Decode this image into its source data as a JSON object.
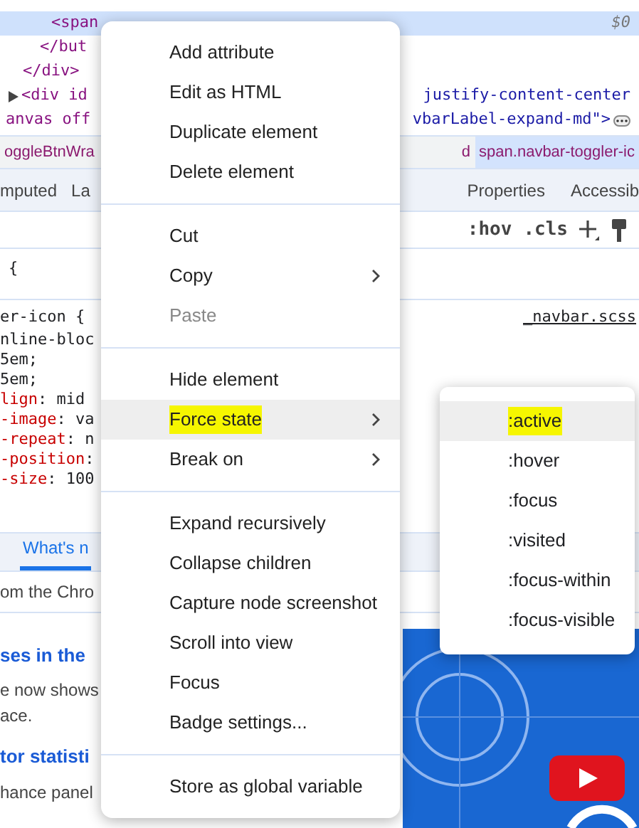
{
  "elements_panel": {
    "lines": [
      {
        "left": "<span",
        "right": "$0",
        "selected": true
      },
      {
        "left": "</but",
        "selected": false
      },
      {
        "left": "</div>",
        "selected": false
      },
      {
        "left": "<div id",
        "right": "justify-content-center",
        "selected": false
      },
      {
        "left": "anvas off",
        "right": "vbarLabel-expand-md\">",
        "selected": false
      }
    ],
    "breadcrumbs": [
      {
        "label": "oggleBtnWra",
        "selected": false
      },
      {
        "label": "d",
        "selected": false
      },
      {
        "label": "span.navbar-toggler-ic",
        "selected": true
      }
    ]
  },
  "sidebar_tabs": [
    {
      "label": "mputed",
      "selected": false
    },
    {
      "label": "La",
      "selected": false
    },
    {
      "label": "Properties",
      "selected": false
    },
    {
      "label": "Accessib",
      "selected": false
    }
  ],
  "styles_toolbar": {
    "hov": ":hov",
    "cls": ".cls"
  },
  "styles": {
    "brace": "{",
    "selector": "er-icon {",
    "source": "_navbar.scss",
    "declarations": [
      {
        "prop": "nline-bloc"
      },
      {
        "prop": "5em;"
      },
      {
        "prop": " 5em;"
      },
      {
        "prop": "lign",
        "value": ": mid"
      },
      {
        "prop": "-image",
        "value": ": va"
      },
      {
        "prop": "-repeat",
        "value": ": n"
      },
      {
        "prop": "-position",
        "value": ":"
      },
      {
        "prop": "-size",
        "value": ": 100"
      }
    ]
  },
  "drawer": {
    "tab": "What's n",
    "intro": "om the Chro",
    "sections": [
      {
        "heading": "ses in the",
        "body": [
          "e now shows",
          "ace."
        ]
      },
      {
        "heading": "tor statisti",
        "body": [
          "hance panel"
        ]
      }
    ]
  },
  "context_menu": {
    "groups": [
      [
        {
          "label": "Add attribute",
          "submenu": false,
          "disabled": false,
          "selected": false,
          "marked": false
        },
        {
          "label": "Edit as HTML",
          "submenu": false,
          "disabled": false,
          "selected": false,
          "marked": false
        },
        {
          "label": "Duplicate element",
          "submenu": false,
          "disabled": false,
          "selected": false,
          "marked": false
        },
        {
          "label": "Delete element",
          "submenu": false,
          "disabled": false,
          "selected": false,
          "marked": false
        }
      ],
      [
        {
          "label": "Cut",
          "submenu": false,
          "disabled": false,
          "selected": false,
          "marked": false
        },
        {
          "label": "Copy",
          "submenu": true,
          "disabled": false,
          "selected": false,
          "marked": false
        },
        {
          "label": "Paste",
          "submenu": false,
          "disabled": true,
          "selected": false,
          "marked": false
        }
      ],
      [
        {
          "label": "Hide element",
          "submenu": false,
          "disabled": false,
          "selected": false,
          "marked": false
        },
        {
          "label": "Force state",
          "submenu": true,
          "disabled": false,
          "selected": true,
          "marked": true
        },
        {
          "label": "Break on",
          "submenu": true,
          "disabled": false,
          "selected": false,
          "marked": false
        }
      ],
      [
        {
          "label": "Expand recursively",
          "submenu": false,
          "disabled": false,
          "selected": false,
          "marked": false
        },
        {
          "label": "Collapse children",
          "submenu": false,
          "disabled": false,
          "selected": false,
          "marked": false
        },
        {
          "label": "Capture node screenshot",
          "submenu": false,
          "disabled": false,
          "selected": false,
          "marked": false
        },
        {
          "label": "Scroll into view",
          "submenu": false,
          "disabled": false,
          "selected": false,
          "marked": false
        },
        {
          "label": "Focus",
          "submenu": false,
          "disabled": false,
          "selected": false,
          "marked": false
        },
        {
          "label": "Badge settings...",
          "submenu": false,
          "disabled": false,
          "selected": false,
          "marked": false
        }
      ],
      [
        {
          "label": "Store as global variable",
          "submenu": false,
          "disabled": false,
          "selected": false,
          "marked": false
        }
      ]
    ]
  },
  "submenu": {
    "items": [
      {
        "label": ":active",
        "selected": true,
        "marked": true
      },
      {
        "label": ":hover",
        "selected": false,
        "marked": false
      },
      {
        "label": ":focus",
        "selected": false,
        "marked": false
      },
      {
        "label": ":visited",
        "selected": false,
        "marked": false
      },
      {
        "label": ":focus-within",
        "selected": false,
        "marked": false
      },
      {
        "label": ":focus-visible",
        "selected": false,
        "marked": false
      }
    ]
  }
}
